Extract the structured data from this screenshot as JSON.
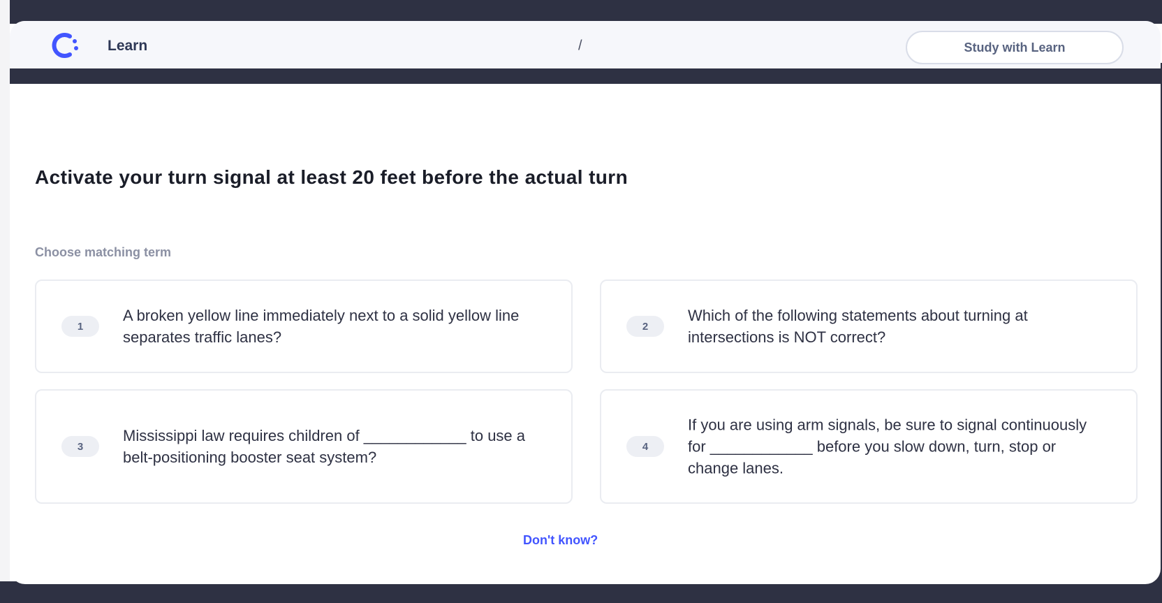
{
  "header": {
    "brand": "Learn",
    "separator": "/",
    "study_button": "Study with Learn",
    "logo_icon": "learn-logo-icon"
  },
  "question": {
    "text": "Activate your turn signal at least 20 feet before the actual turn",
    "prompt": "Choose matching term"
  },
  "options": [
    {
      "number": "1",
      "text": "A broken yellow line immediately next to a solid yellow line separates traffic lanes?"
    },
    {
      "number": "2",
      "text": "Which of the following statements about turning at intersections is NOT correct?"
    },
    {
      "number": "3",
      "text": "Mississippi law requires children of ____________ to use a belt-positioning booster seat system?"
    },
    {
      "number": "4",
      "text": "If you are using arm signals, be sure to signal continuously for ____________ before you slow down, turn, stop or change lanes."
    }
  ],
  "footer": {
    "dont_know": "Don't know?"
  },
  "colors": {
    "accent": "#4255ff",
    "dark_band": "#2e3143",
    "header_bg": "#f6f7fb",
    "border": "#eaecf1"
  }
}
